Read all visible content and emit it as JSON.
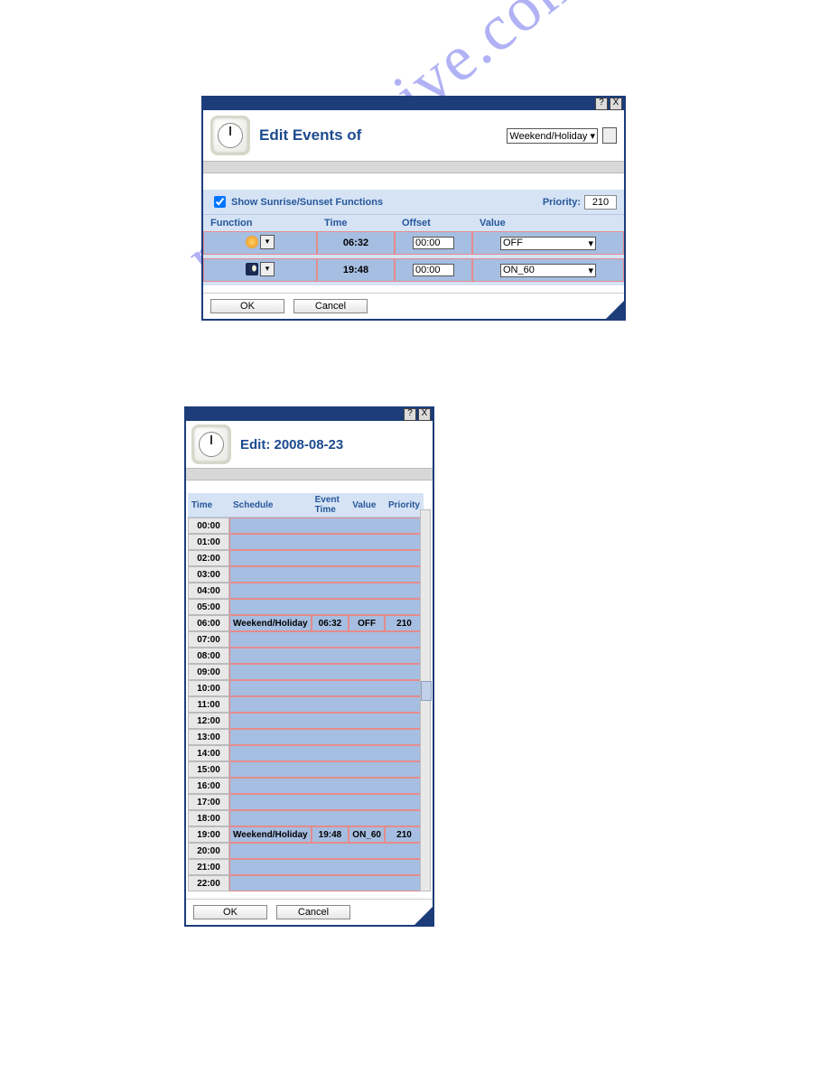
{
  "watermark": "manualshive.com",
  "window1": {
    "title": "Edit Events of",
    "schedule_select": "Weekend/Holiday",
    "show_sun": "Show Sunrise/Sunset Functions",
    "priority_label": "Priority:",
    "priority_value": "210",
    "cols": {
      "function": "Function",
      "time": "Time",
      "offset": "Offset",
      "value": "Value"
    },
    "rows": [
      {
        "icon": "sun",
        "time": "06:32",
        "offset": "00:00",
        "value": "OFF"
      },
      {
        "icon": "moon",
        "time": "19:48",
        "offset": "00:00",
        "value": "ON_60"
      }
    ],
    "ok": "OK",
    "cancel": "Cancel"
  },
  "window2": {
    "title": "Edit: 2008-08-23",
    "cols": {
      "time": "Time",
      "schedule": "Schedule",
      "evtime": "Event Time",
      "value": "Value",
      "priority": "Priority"
    },
    "hours": [
      {
        "t": "00:00"
      },
      {
        "t": "01:00"
      },
      {
        "t": "02:00"
      },
      {
        "t": "03:00"
      },
      {
        "t": "04:00"
      },
      {
        "t": "05:00"
      },
      {
        "t": "06:00",
        "schedule": "Weekend/Holiday",
        "evtime": "06:32",
        "value": "OFF",
        "priority": "210"
      },
      {
        "t": "07:00"
      },
      {
        "t": "08:00"
      },
      {
        "t": "09:00"
      },
      {
        "t": "10:00"
      },
      {
        "t": "11:00"
      },
      {
        "t": "12:00"
      },
      {
        "t": "13:00"
      },
      {
        "t": "14:00"
      },
      {
        "t": "15:00"
      },
      {
        "t": "16:00"
      },
      {
        "t": "17:00"
      },
      {
        "t": "18:00"
      },
      {
        "t": "19:00",
        "schedule": "Weekend/Holiday",
        "evtime": "19:48",
        "value": "ON_60",
        "priority": "210"
      },
      {
        "t": "20:00"
      },
      {
        "t": "21:00"
      },
      {
        "t": "22:00"
      }
    ],
    "ok": "OK",
    "cancel": "Cancel"
  }
}
